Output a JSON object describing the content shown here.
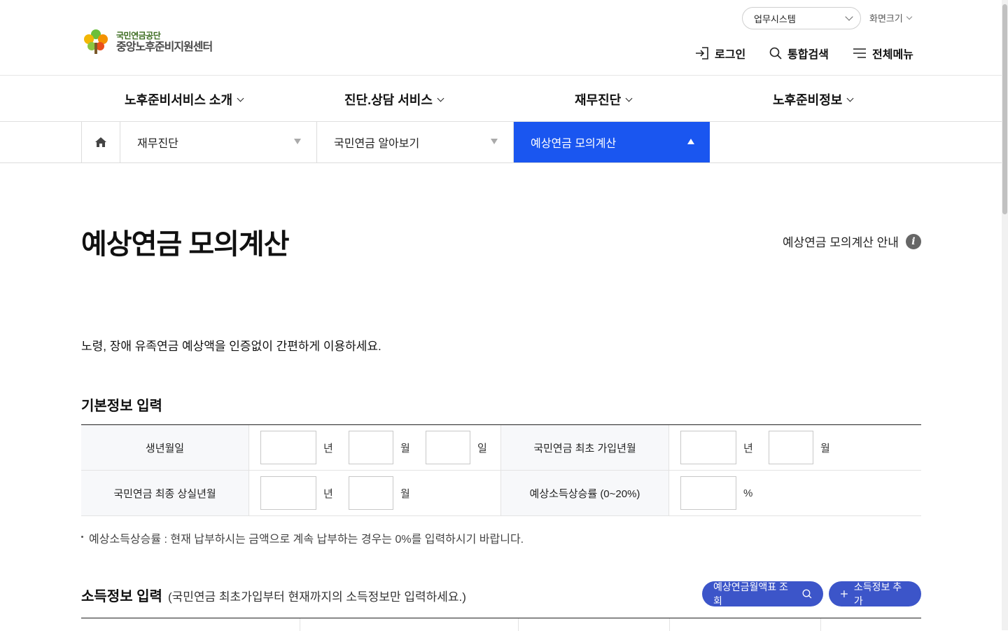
{
  "header": {
    "logo_top": "국민연금공단",
    "logo_bottom": "중앙노후준비지원센터",
    "work_system": "업무시스템",
    "screen_size": "화면크기",
    "login": "로그인",
    "search": "통합검색",
    "all_menu": "전체메뉴"
  },
  "gnb": [
    {
      "label": "노후준비서비스 소개"
    },
    {
      "label": "진단.상담 서비스"
    },
    {
      "label": "재무진단"
    },
    {
      "label": "노후준비정보"
    }
  ],
  "location": {
    "depth1": "재무진단",
    "depth2": "국민연금 알아보기",
    "depth3": "예상연금 모의계산"
  },
  "page": {
    "title": "예상연금 모의계산",
    "guide": "예상연금 모의계산 안내",
    "intro": "노령, 장애 유족연금 예상액을 인증없이 간편하게 이용하세요."
  },
  "basic_info": {
    "title": "기본정보 입력",
    "birth_label": "생년월일",
    "first_join_label": "국민연금 최초 가입년월",
    "last_loss_label": "국민연금 최종 상실년월",
    "income_rate_label": "예상소득상승률 (0~20%)",
    "unit_year": "년",
    "unit_month": "월",
    "unit_day": "일",
    "unit_percent": "%",
    "note": "예상소득상승률 : 현재 납부하시는 금액으로 계속 납부하는 경우는 0%를 입력하시기 바랍니다."
  },
  "income_info": {
    "title": "소득정보 입력",
    "subtitle": "(국민연금 최초가입부터 현재까지의 소득정보만 입력하세요.)",
    "lookup_button": "예상연금월액표 조회",
    "add_button": "소득정보 추가"
  },
  "colors": {
    "active_tab": "#1a56f0",
    "button": "#3c55c9"
  }
}
